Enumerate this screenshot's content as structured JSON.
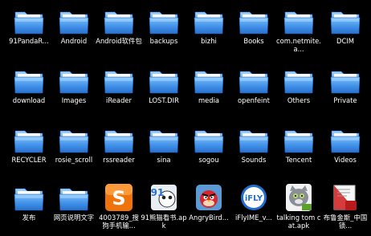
{
  "items": [
    {
      "label": "91PandaR...",
      "icon": "folder-icon"
    },
    {
      "label": "Android",
      "icon": "folder-icon"
    },
    {
      "label": "Android软件包",
      "icon": "folder-icon"
    },
    {
      "label": "backups",
      "icon": "folder-icon"
    },
    {
      "label": "bizhi",
      "icon": "folder-icon"
    },
    {
      "label": "Books",
      "icon": "folder-icon"
    },
    {
      "label": "com.netmite.a...",
      "icon": "folder-icon"
    },
    {
      "label": "DCIM",
      "icon": "folder-icon"
    },
    {
      "label": "download",
      "icon": "folder-icon"
    },
    {
      "label": "Images",
      "icon": "folder-icon"
    },
    {
      "label": "iReader",
      "icon": "folder-icon"
    },
    {
      "label": "LOST.DIR",
      "icon": "folder-icon"
    },
    {
      "label": "media",
      "icon": "folder-icon"
    },
    {
      "label": "openfeint",
      "icon": "folder-icon"
    },
    {
      "label": "Others",
      "icon": "folder-icon"
    },
    {
      "label": "Private",
      "icon": "folder-icon"
    },
    {
      "label": "RECYCLER",
      "icon": "folder-icon"
    },
    {
      "label": "rosie_scroll",
      "icon": "folder-icon"
    },
    {
      "label": "rssreader",
      "icon": "folder-icon"
    },
    {
      "label": "sina",
      "icon": "folder-icon"
    },
    {
      "label": "sogou",
      "icon": "folder-icon"
    },
    {
      "label": "Sounds",
      "icon": "folder-icon"
    },
    {
      "label": "Tencent",
      "icon": "folder-icon"
    },
    {
      "label": "Videos",
      "icon": "folder-icon"
    },
    {
      "label": "发布",
      "icon": "folder-icon"
    },
    {
      "label": "网页说明文字",
      "icon": "folder-icon"
    },
    {
      "label": "4003789_搜狗手机输...",
      "icon": "sogou-input-app-icon"
    },
    {
      "label": "91熊猫看书.apk",
      "icon": "panda-reader-app-icon"
    },
    {
      "label": "AngryBird...",
      "icon": "angry-birds-app-icon"
    },
    {
      "label": "iFlyIME_v...",
      "icon": "ifly-ime-app-icon"
    },
    {
      "label": "talking tom cat.apk",
      "icon": "talking-tom-cat-app-icon"
    },
    {
      "label": "布鲁金斯_中国锁...",
      "icon": "pdf-document-icon"
    }
  ],
  "colors": {
    "background": "#000000",
    "folder_blue": "#3d8ee6",
    "label": "#ffffff",
    "sogou_orange": "#f0720a"
  },
  "icon_texts": {
    "sogou": "S",
    "panda": "91",
    "ifly": "iFLY"
  }
}
